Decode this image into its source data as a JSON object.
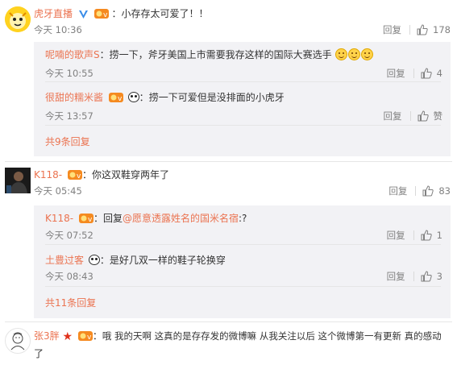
{
  "comments": [
    {
      "user": "虎牙直播",
      "text": "小存存太可爱了！！",
      "time": "今天 10:36",
      "reply_label": "回复",
      "likes": "178",
      "replies": [
        {
          "user": "呢喃的歌声S",
          "text": "捞一下，斧牙美国上市需要我存这样的国际大赛选手",
          "time": "今天 10:55",
          "reply_label": "回复",
          "likes": "4"
        },
        {
          "user": "很甜的糯米酱",
          "text": "捞一下可爱但是没排面的小虎牙",
          "time": "今天 13:57",
          "reply_label": "回复",
          "likes": "赞"
        }
      ],
      "more_label": "共9条回复"
    },
    {
      "user": "K118-",
      "text": "你这双鞋穿两年了",
      "time": "今天 05:45",
      "reply_label": "回复",
      "likes": "83",
      "replies": [
        {
          "user": "K118-",
          "reply_prefix": "回复",
          "mention": "@愿意透露姓名的国米名宿",
          "text": ":?",
          "time": "今天 07:52",
          "reply_label": "回复",
          "likes": "1"
        },
        {
          "user": "土豊过客",
          "text": "是好几双一样的鞋子轮换穿",
          "time": "今天 08:43",
          "reply_label": "回复",
          "likes": "3"
        }
      ],
      "more_label": "共11条回复"
    },
    {
      "user": "张3胖",
      "text": "哦 我的天啊 这真的是存存发的微博嘛 从我关注以后 这个微博第一有更新 真的感动",
      "text_wrap": "了"
    }
  ],
  "colors": {
    "name": "#eb7350",
    "meta": "#808080",
    "subbox": "#f2f2f5",
    "verified": "#3a8de8"
  }
}
